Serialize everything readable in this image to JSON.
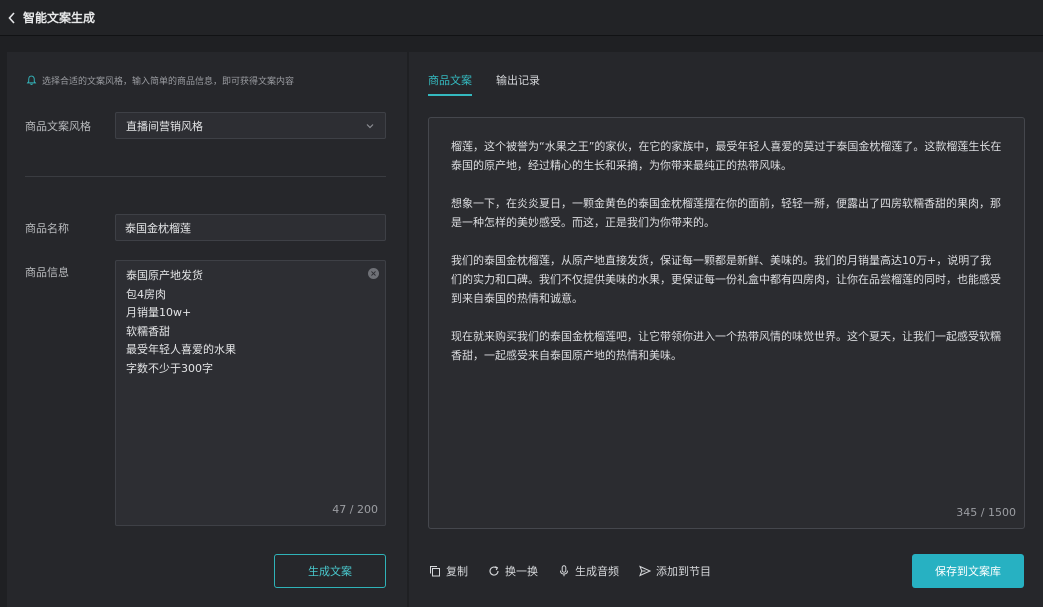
{
  "header": {
    "title": "智能文案生成"
  },
  "form": {
    "hint": "选择合适的文案风格，输入简单的商品信息，即可获得文案内容",
    "style_label": "商品文案风格",
    "style_value": "直播间营销风格",
    "name_label": "商品名称",
    "name_value": "泰国金枕榴莲",
    "info_label": "商品信息",
    "info_lines": [
      "泰国原产地发货",
      "包4房肉",
      "月销量10w+",
      "软糯香甜",
      "最受年轻人喜爱的水果",
      "字数不少于300字"
    ],
    "info_counter": "47 / 200",
    "generate_label": "生成文案"
  },
  "output": {
    "tabs": [
      {
        "label": "商品文案",
        "active": true
      },
      {
        "label": "输出记录",
        "active": false
      }
    ],
    "paragraphs": [
      "榴莲，这个被誉为“水果之王”的家伙，在它的家族中，最受年轻人喜爱的莫过于泰国金枕榴莲了。这款榴莲生长在泰国的原产地，经过精心的生长和采摘，为你带来最纯正的热带风味。",
      "想象一下，在炎炎夏日，一颗金黄色的泰国金枕榴莲摆在你的面前，轻轻一掰，便露出了四房软糯香甜的果肉，那是一种怎样的美妙感受。而这，正是我们为你带来的。",
      "我们的泰国金枕榴莲，从原产地直接发货，保证每一颗都是新鲜、美味的。我们的月销量高达10万+，说明了我们的实力和口碑。我们不仅提供美味的水果，更保证每一份礼盒中都有四房肉，让你在品尝榴莲的同时，也能感受到来自泰国的热情和诚意。",
      "现在就来购买我们的泰国金枕榴莲吧，让它带领你进入一个热带风情的味觉世界。这个夏天，让我们一起感受软糯香甜，一起感受来自泰国原产地的热情和美味。"
    ],
    "counter": "345 / 1500",
    "actions": {
      "copy": "复制",
      "swap": "换一换",
      "audio": "生成音频",
      "add": "添加到节目"
    },
    "save_label": "保存到文案库"
  },
  "colors": {
    "accent": "#34b9bf",
    "primary_button": "#27b1c2",
    "background": "#1f2023",
    "panel": "#26272b"
  },
  "icons": [
    "back-icon",
    "bell-icon",
    "chevron-down-icon",
    "clear-icon",
    "copy-icon",
    "refresh-icon",
    "microphone-icon",
    "send-icon"
  ]
}
